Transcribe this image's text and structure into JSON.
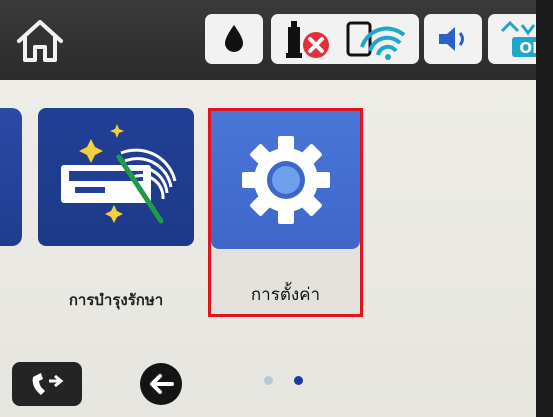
{
  "topbar": {
    "home_icon": "home-icon",
    "status": {
      "ink_icon": "ink-drop-icon",
      "network_icons": [
        "wired-network-error-icon",
        "wifi-icon"
      ],
      "volume_icon": "speaker-icon",
      "wifi_direct_label": "ON"
    }
  },
  "tiles": [
    {
      "id": "maintenance",
      "label": "การบำรุงรักษา",
      "icon": "printer-maintenance-icon"
    },
    {
      "id": "settings",
      "label": "การตั้งค่า",
      "icon": "gear-icon",
      "selected": true
    }
  ],
  "bottombar": {
    "fax_icon": "fax-contacts-icon",
    "back_icon": "back-arrow-icon",
    "page_indicator": {
      "total": 2,
      "current": 2
    }
  },
  "colors": {
    "tile_blue": "#213f95",
    "settings_blue": "#4a76d8",
    "selection_border": "#e0151d",
    "error_red": "#e0303a"
  }
}
